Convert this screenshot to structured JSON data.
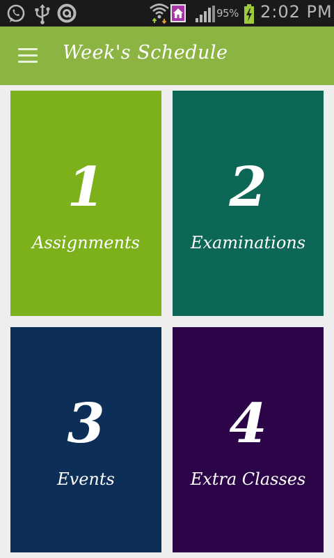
{
  "status_bar": {
    "icons": [
      "whatsapp-icon",
      "usb-icon",
      "notification-icon",
      "wifi-icon",
      "home-icon",
      "signal-icon",
      "battery-icon"
    ],
    "battery_percent": "95%",
    "time": "2:02 PM"
  },
  "app_bar": {
    "menu_icon": "hamburger-menu-icon",
    "title": "Week's Schedule"
  },
  "tiles": [
    {
      "number": "1",
      "label": "Assignments",
      "color": "#7cb11c"
    },
    {
      "number": "2",
      "label": "Examinations",
      "color": "#0d6757"
    },
    {
      "number": "3",
      "label": "Events",
      "color": "#0c2e57"
    },
    {
      "number": "4",
      "label": "Extra Classes",
      "color": "#2b0547"
    }
  ]
}
